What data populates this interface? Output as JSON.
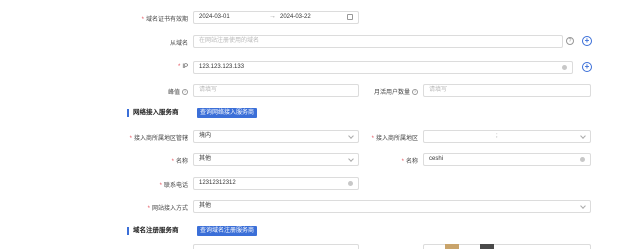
{
  "cert": {
    "label": "域名证书有效期",
    "start": "2024-03-01",
    "end": "2024-03-22"
  },
  "subdomain": {
    "label": "从域名",
    "placeholder": "在网站注册使用的域名"
  },
  "ip": {
    "label": "IP",
    "value": "123.123.123.133"
  },
  "peak": {
    "label": "峰值",
    "placeholder": "请填写"
  },
  "monthly_users": {
    "label": "月活用户数量",
    "placeholder": "请填写"
  },
  "network_section": {
    "title": "网络接入服务商",
    "button": "查询网络接入服务商"
  },
  "access_region": {
    "label": "接入商所属地区管辖",
    "value": "境内"
  },
  "access_area": {
    "label": "接入商所属地区",
    "value": ""
  },
  "name1": {
    "label": "名称",
    "value": "其他"
  },
  "name2": {
    "label": "名称",
    "value": "ceshi"
  },
  "phone": {
    "label": "联系电话",
    "value": "12312312312"
  },
  "access_method": {
    "label": "网站接入方式",
    "value": "其他"
  },
  "registrar_section": {
    "title": "域名注册服务商",
    "button": "查询域名注册服务商"
  }
}
